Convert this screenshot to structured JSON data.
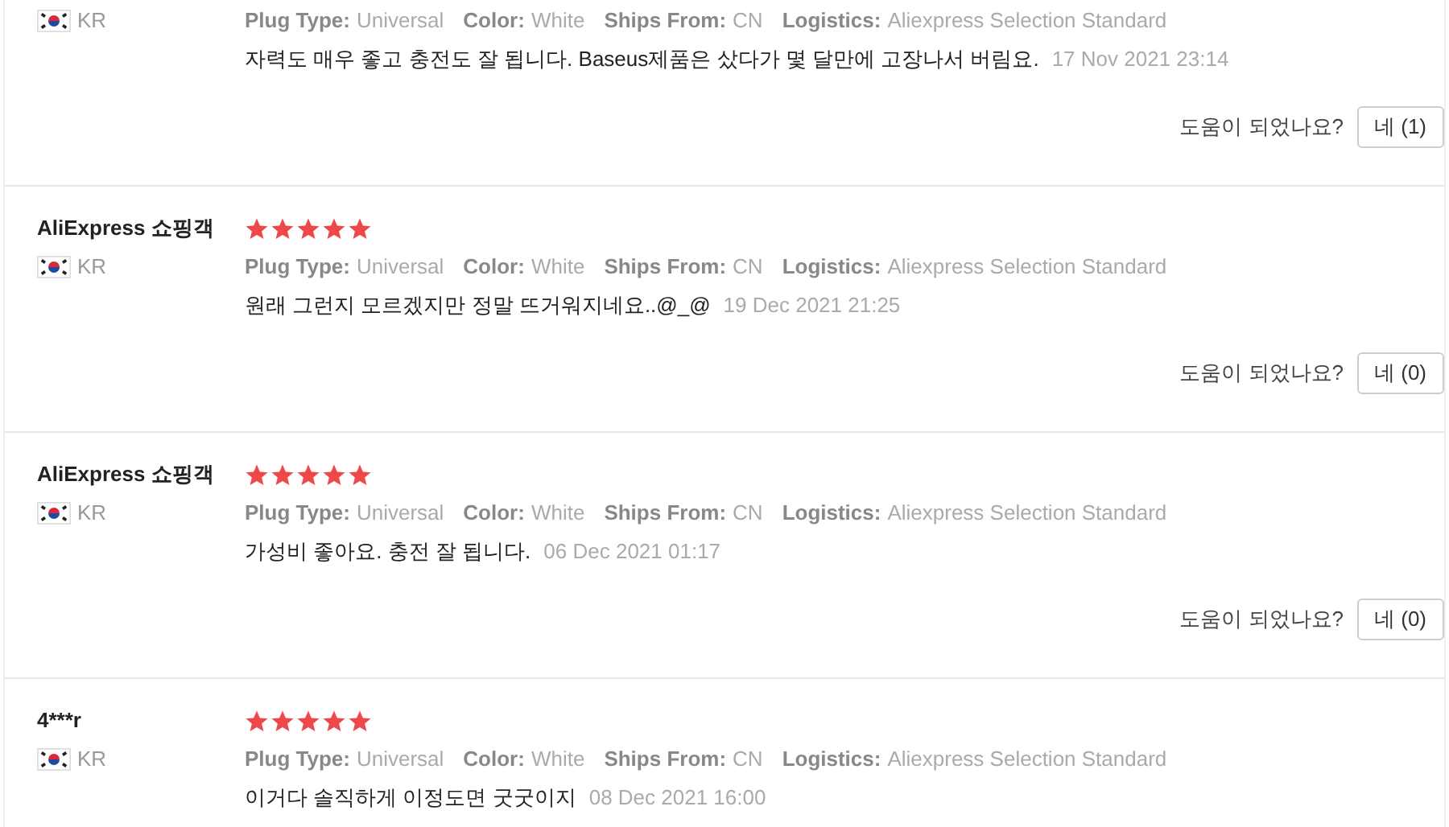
{
  "reviews": [
    {
      "country": "KR",
      "attributes": [
        {
          "label": "Plug Type:",
          "value": "Universal"
        },
        {
          "label": "Color:",
          "value": "White"
        },
        {
          "label": "Ships From:",
          "value": "CN"
        },
        {
          "label": "Logistics:",
          "value": "Aliexpress Selection Standard"
        }
      ],
      "text": "자력도 매우 좋고 충전도 잘 됩니다. Baseus제품은 샀다가 몇 달만에 고장나서 버림요.",
      "date": "17 Nov 2021 23:14",
      "helpful": {
        "question": "도움이 되었나요?",
        "button": "네 (1)"
      }
    },
    {
      "name": "AliExpress 쇼핑객",
      "stars": 5,
      "country": "KR",
      "attributes": [
        {
          "label": "Plug Type:",
          "value": "Universal"
        },
        {
          "label": "Color:",
          "value": "White"
        },
        {
          "label": "Ships From:",
          "value": "CN"
        },
        {
          "label": "Logistics:",
          "value": "Aliexpress Selection Standard"
        }
      ],
      "text": "원래 그런지 모르겠지만 정말 뜨거워지네요..@_@",
      "date": "19 Dec 2021 21:25",
      "helpful": {
        "question": "도움이 되었나요?",
        "button": "네 (0)"
      }
    },
    {
      "name": "AliExpress 쇼핑객",
      "stars": 5,
      "country": "KR",
      "attributes": [
        {
          "label": "Plug Type:",
          "value": "Universal"
        },
        {
          "label": "Color:",
          "value": "White"
        },
        {
          "label": "Ships From:",
          "value": "CN"
        },
        {
          "label": "Logistics:",
          "value": "Aliexpress Selection Standard"
        }
      ],
      "text": "가성비 좋아요. 충전 잘 됩니다.",
      "date": "06 Dec 2021 01:17",
      "helpful": {
        "question": "도움이 되었나요?",
        "button": "네 (0)"
      }
    },
    {
      "name": "4***r",
      "stars": 5,
      "country": "KR",
      "attributes": [
        {
          "label": "Plug Type:",
          "value": "Universal"
        },
        {
          "label": "Color:",
          "value": "White"
        },
        {
          "label": "Ships From:",
          "value": "CN"
        },
        {
          "label": "Logistics:",
          "value": "Aliexpress Selection Standard"
        }
      ],
      "text": "이거다 솔직하게 이정도면 굿굿이지",
      "date": "08 Dec 2021 16:00"
    }
  ]
}
